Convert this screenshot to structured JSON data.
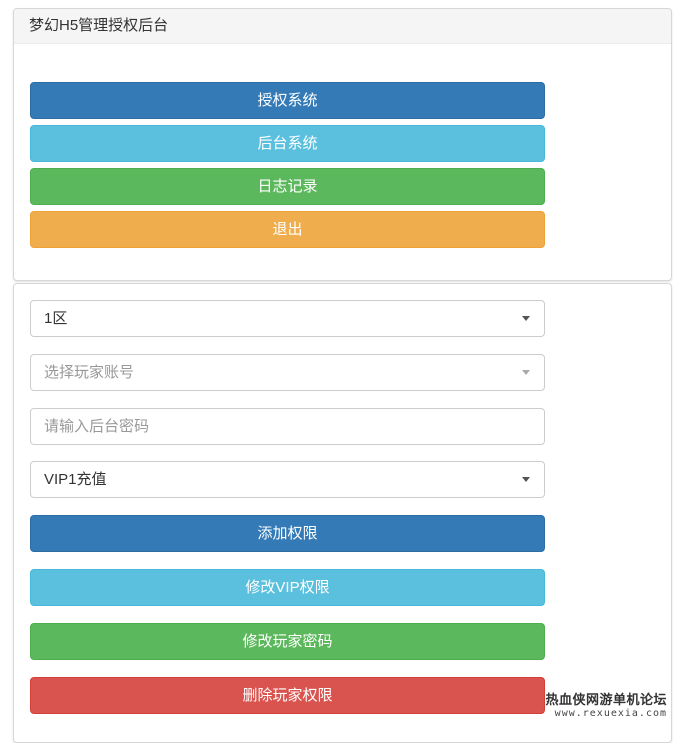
{
  "header": {
    "title": "梦幻H5管理授权后台"
  },
  "nav_buttons": {
    "auth_system": "授权系统",
    "backend_system": "后台系统",
    "log_records": "日志记录",
    "logout": "退出"
  },
  "form": {
    "server_select": "1区",
    "player_select_placeholder": "选择玩家账号",
    "password_placeholder": "请输入后台密码",
    "vip_select": "VIP1充值",
    "add_permission": "添加权限",
    "modify_vip": "修改VIP权限",
    "modify_password": "修改玩家密码",
    "delete_permission": "删除玩家权限"
  },
  "watermark": {
    "line1": "热血侠网游单机论坛",
    "line2": "www.rexuexia.com"
  }
}
